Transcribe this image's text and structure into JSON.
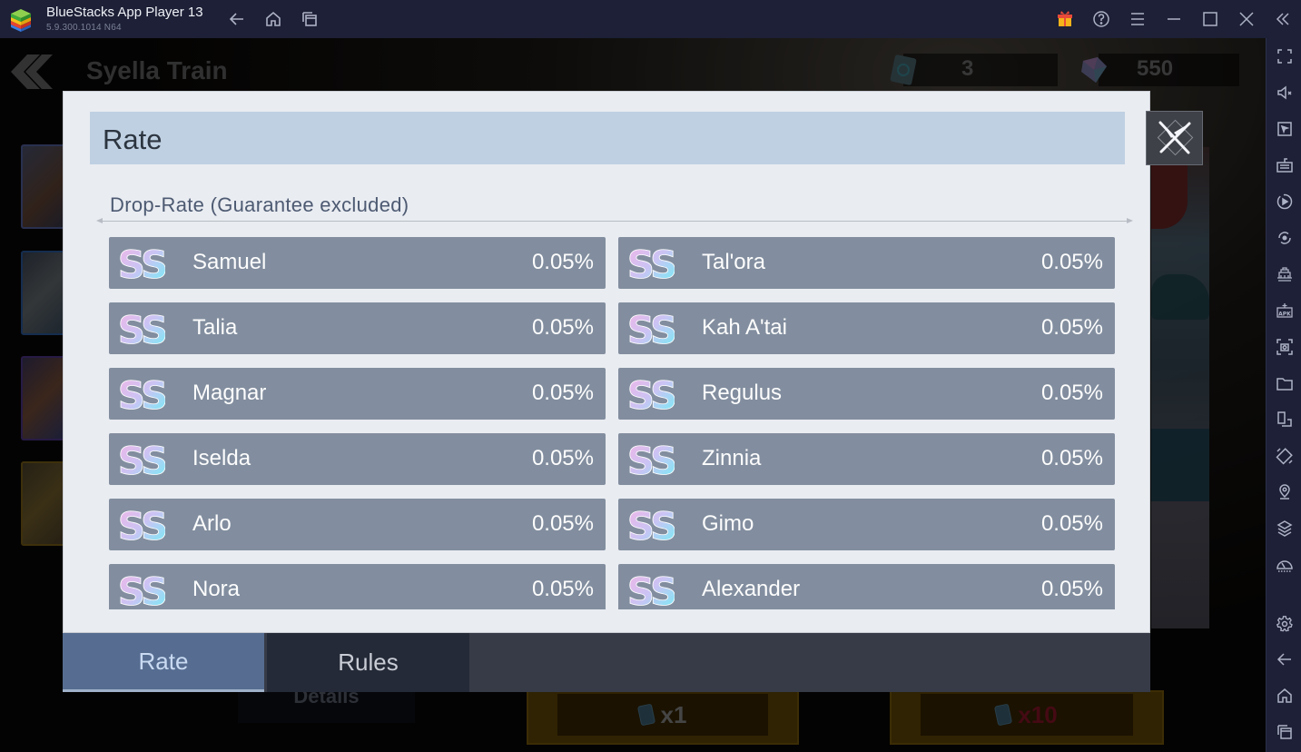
{
  "window": {
    "title": "BlueStacks App Player 13",
    "version": "5.9.300.1014  N64",
    "toolbar_icons": [
      "back-icon",
      "home-icon",
      "recent-apps-icon"
    ],
    "window_controls": [
      "gift-icon",
      "help-icon",
      "menu-icon",
      "minimize-icon",
      "maximize-icon",
      "close-icon",
      "collapse-sidebar-icon"
    ]
  },
  "sidebar": {
    "items": [
      {
        "name": "fullscreen",
        "icon": "fullscreen-icon"
      },
      {
        "name": "volume",
        "icon": "volume-mute-icon"
      },
      {
        "name": "pointer",
        "icon": "cursor-icon"
      },
      {
        "name": "keyboard",
        "icon": "keyboard-icon"
      },
      {
        "name": "macro",
        "icon": "record-icon"
      },
      {
        "name": "rotate-sync",
        "icon": "sync-icon"
      },
      {
        "name": "performance",
        "icon": "eco-mode-icon"
      },
      {
        "name": "install-apk",
        "icon": "apk-icon"
      },
      {
        "name": "screenshot",
        "icon": "screenshot-icon"
      },
      {
        "name": "media-folder",
        "icon": "folder-icon"
      },
      {
        "name": "multi-instance",
        "icon": "multi-instance-icon"
      },
      {
        "name": "rotate",
        "icon": "rotate-icon"
      },
      {
        "name": "location",
        "icon": "location-icon"
      },
      {
        "name": "layers",
        "icon": "layers-icon"
      },
      {
        "name": "speed",
        "icon": "gauge-icon"
      },
      {
        "name": "settings",
        "icon": "gear-icon"
      },
      {
        "name": "back",
        "icon": "back-arrow-icon"
      },
      {
        "name": "home",
        "icon": "home-icon"
      },
      {
        "name": "recent",
        "icon": "recent-apps-icon"
      }
    ]
  },
  "game": {
    "title": "Syella Train",
    "currencies": [
      {
        "name": "summon-ticket",
        "icon": "ticket-icon",
        "value": "3"
      },
      {
        "name": "gems",
        "icon": "gem-icon",
        "value": "550"
      }
    ],
    "details_label": "Details",
    "summon_buttons": [
      {
        "label": "x1",
        "color": "#6b6b6b"
      },
      {
        "label": "x10",
        "color": "#6a1020"
      }
    ]
  },
  "dialog": {
    "title": "Rate",
    "section_title": "Drop-Rate (Guarantee excluded)",
    "grade_label": "SS",
    "entries": [
      {
        "grade": "SS",
        "name": "Samuel",
        "rate": "0.05%"
      },
      {
        "grade": "SS",
        "name": "Tal'ora",
        "rate": "0.05%"
      },
      {
        "grade": "SS",
        "name": "Talia",
        "rate": "0.05%"
      },
      {
        "grade": "SS",
        "name": "Kah A'tai",
        "rate": "0.05%"
      },
      {
        "grade": "SS",
        "name": "Magnar",
        "rate": "0.05%"
      },
      {
        "grade": "SS",
        "name": "Regulus",
        "rate": "0.05%"
      },
      {
        "grade": "SS",
        "name": "Iselda",
        "rate": "0.05%"
      },
      {
        "grade": "SS",
        "name": "Zinnia",
        "rate": "0.05%"
      },
      {
        "grade": "SS",
        "name": "Arlo",
        "rate": "0.05%"
      },
      {
        "grade": "SS",
        "name": "Gimo",
        "rate": "0.05%"
      },
      {
        "grade": "SS",
        "name": "Nora",
        "rate": "0.05%"
      },
      {
        "grade": "SS",
        "name": "Alexander",
        "rate": "0.05%"
      }
    ],
    "tabs": [
      {
        "label": "Rate",
        "active": true
      },
      {
        "label": "Rules",
        "active": false
      }
    ]
  },
  "colors": {
    "titlebar": "#1d2036",
    "dialog_bg": "#e9ecf1",
    "header_bg": "#bfd0e2",
    "row_bg": "#828e9f",
    "tab_active": "#566d91",
    "tab_inactive": "#252a38"
  }
}
